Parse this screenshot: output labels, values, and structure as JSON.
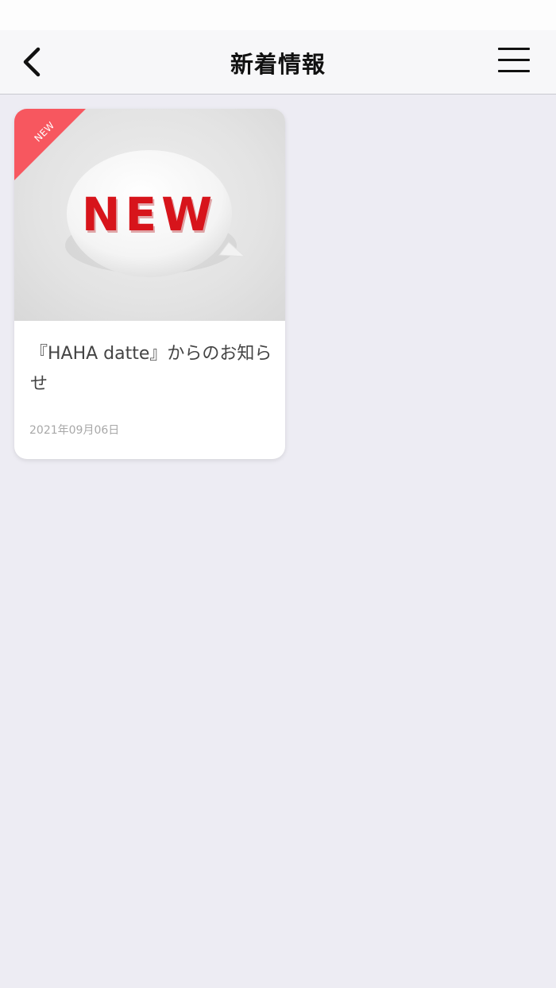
{
  "header": {
    "title": "新着情報",
    "back_icon": "chevron-left-icon",
    "menu_icon": "hamburger-menu-icon"
  },
  "news": [
    {
      "badge": "NEW",
      "image_text": "NEW",
      "title": "『HAHA datte』からのお知らせ",
      "date": "2021年09月06日"
    }
  ],
  "colors": {
    "badge": "#f7575f",
    "image_text": "#d7141b",
    "background": "#edecf3"
  }
}
